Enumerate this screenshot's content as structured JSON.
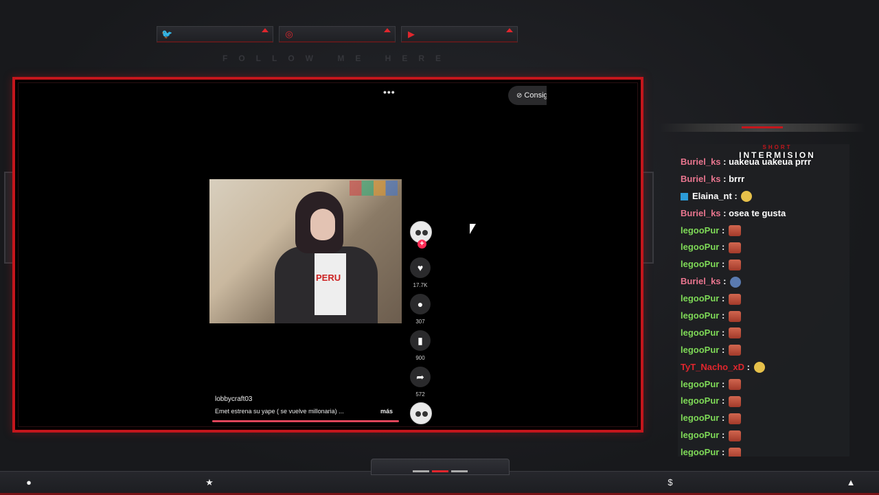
{
  "overlay": {
    "follow_text": "FOLLOW ME HERE",
    "social": [
      {
        "icon": "twitter-icon",
        "glyph": "🐦"
      },
      {
        "icon": "instagram-icon",
        "glyph": "◎"
      },
      {
        "icon": "youtube-icon",
        "glyph": "▶"
      }
    ],
    "chat_header_small": "SHORT",
    "chat_header_big": "INTERMISION"
  },
  "player": {
    "more": "•••",
    "consig_label": "Consig",
    "username": "lobbycraft03",
    "caption": "Emet estrena su yape ( se vuelve millonaria) ...",
    "more_label": "más",
    "video_shirt_text": "PERU",
    "likes": "17.7K",
    "comments": "307",
    "saves": "900",
    "shares": "572",
    "progress": 1.0
  },
  "chat": {
    "messages": [
      {
        "user": "Buriel_ks",
        "text": "uakeua uakeua prrr",
        "color": "#e8758e",
        "emote": null
      },
      {
        "user": "Buriel_ks",
        "text": "brrr",
        "color": "#e8758e",
        "emote": null
      },
      {
        "user": "Elaina_nt",
        "text": "",
        "color": "#ffffff",
        "emote": "hand",
        "badge": true
      },
      {
        "user": "Buriel_ks",
        "text": "osea te gusta",
        "color": "#e8758e",
        "emote": null
      },
      {
        "user": "legooPur",
        "text": "",
        "color": "#7ed957",
        "emote": "face"
      },
      {
        "user": "legooPur",
        "text": "",
        "color": "#7ed957",
        "emote": "face"
      },
      {
        "user": "legooPur",
        "text": "",
        "color": "#7ed957",
        "emote": "face"
      },
      {
        "user": "Buriel_ks",
        "text": "",
        "color": "#e8758e",
        "emote": "blue"
      },
      {
        "user": "legooPur",
        "text": "",
        "color": "#7ed957",
        "emote": "face"
      },
      {
        "user": "legooPur",
        "text": "",
        "color": "#7ed957",
        "emote": "face"
      },
      {
        "user": "legooPur",
        "text": "",
        "color": "#7ed957",
        "emote": "face"
      },
      {
        "user": "legooPur",
        "text": "",
        "color": "#7ed957",
        "emote": "face"
      },
      {
        "user": "TyT_Nacho_xD",
        "text": "",
        "color": "#e0262d",
        "emote": "hand"
      },
      {
        "user": "legooPur",
        "text": "",
        "color": "#7ed957",
        "emote": "face"
      },
      {
        "user": "legooPur",
        "text": "",
        "color": "#7ed957",
        "emote": "face"
      },
      {
        "user": "legooPur",
        "text": "",
        "color": "#7ed957",
        "emote": "face"
      },
      {
        "user": "legooPur",
        "text": "",
        "color": "#7ed957",
        "emote": "face"
      },
      {
        "user": "legooPur",
        "text": "",
        "color": "#7ed957",
        "emote": "face"
      }
    ]
  },
  "bottom": {
    "icons": [
      {
        "name": "user-icon",
        "glyph": "●"
      },
      {
        "name": "star-icon",
        "glyph": "★"
      },
      {
        "name": "dollar-icon",
        "glyph": "$"
      },
      {
        "name": "drop-icon",
        "glyph": "▲"
      }
    ]
  },
  "colors": {
    "accent": "#c4161c",
    "like_pink": "#fe2c55"
  }
}
